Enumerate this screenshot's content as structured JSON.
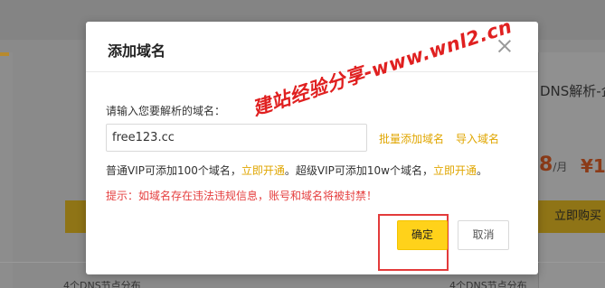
{
  "background": {
    "dns_title": "DNS解析-企",
    "price_value": "8",
    "price_unit": "/月",
    "price_value_2": "¥1",
    "buy_button": "立即购买",
    "feature_left": "4个DNS节点分布",
    "feature_right": "4个DNS节点分布"
  },
  "modal": {
    "title": "添加域名",
    "label": "请输入您要解析的域名：",
    "domain_value": "free123.cc",
    "batch_add_link": "批量添加域名",
    "import_link": "导入域名",
    "quota": {
      "part1": "普通VIP可添加100个域名，",
      "link1": "立即开通",
      "part2": "。超级VIP可添加10w个域名，",
      "link2": "立即开通",
      "part3": "。"
    },
    "warning": "提示：如域名存在违法违规信息，账号和域名将被封禁！",
    "ok_button": "确定",
    "cancel_button": "取消"
  },
  "watermark": "建站经验分享-www.wnl2.cn",
  "colors": {
    "accent": "#ffd21a",
    "link": "#e0a600",
    "warning": "#e54040",
    "highlight": "#e33b3b"
  },
  "icons": {
    "close": "close-icon"
  }
}
